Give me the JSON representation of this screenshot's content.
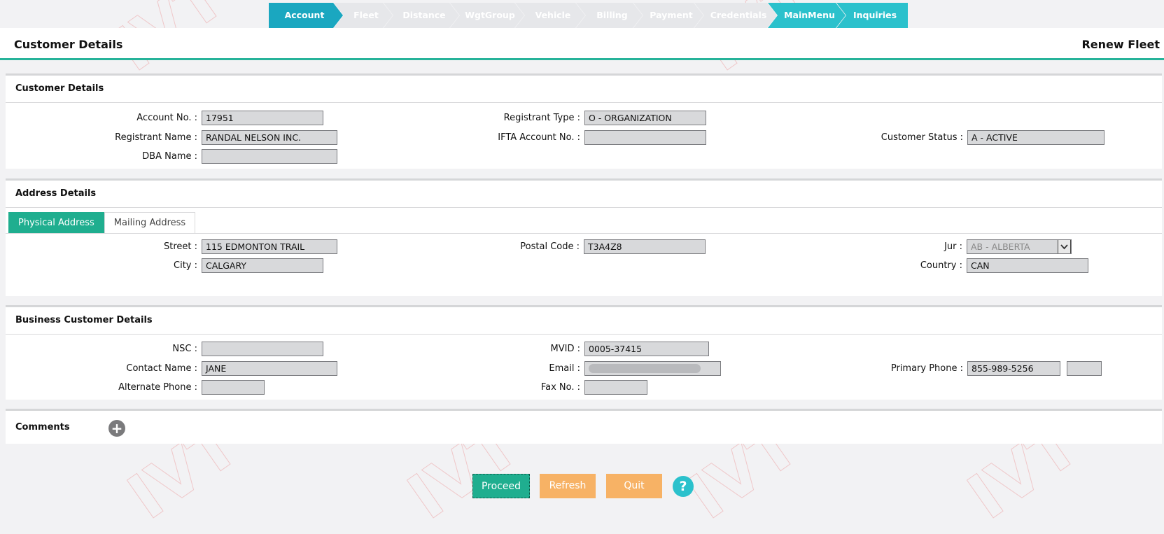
{
  "stepper": {
    "steps": [
      {
        "label": "Account"
      },
      {
        "label": "Fleet"
      },
      {
        "label": "Distance"
      },
      {
        "label": "WgtGroup"
      },
      {
        "label": "Vehicle"
      },
      {
        "label": "Billing"
      },
      {
        "label": "Payment"
      },
      {
        "label": "Credentials"
      },
      {
        "label": "MainMenu"
      },
      {
        "label": "Inquiries"
      }
    ]
  },
  "header": {
    "title": "Customer Details",
    "action": "Renew Fleet"
  },
  "customer_details": {
    "heading": "Customer Details",
    "account_no_label": "Account No.",
    "account_no": "17951",
    "registrant_name_label": "Registrant Name",
    "registrant_name": "RANDAL NELSON INC.",
    "dba_name_label": "DBA Name",
    "dba_name": "",
    "registrant_type_label": "Registrant Type",
    "registrant_type": "O - ORGANIZATION",
    "ifta_label": "IFTA Account No.",
    "ifta": "",
    "status_label": "Customer Status",
    "status": "A - ACTIVE"
  },
  "address_details": {
    "heading": "Address Details",
    "tabs": [
      {
        "label": "Physical Address"
      },
      {
        "label": "Mailing Address"
      }
    ],
    "street_label": "Street",
    "street": "115 EDMONTON TRAIL",
    "city_label": "City",
    "city": "CALGARY",
    "postal_label": "Postal Code",
    "postal": "T3A4Z8",
    "jur_label": "Jur",
    "jur": "AB - ALBERTA",
    "country_label": "Country",
    "country": "CAN"
  },
  "business_details": {
    "heading": "Business Customer Details",
    "nsc_label": "NSC",
    "nsc": "",
    "contact_label": "Contact Name",
    "contact": "JANE",
    "alt_phone_label": "Alternate Phone",
    "alt_phone": "",
    "mvid_label": "MVID",
    "mvid": "0005-37415",
    "email_label": "Email",
    "fax_label": "Fax No.",
    "fax": "",
    "primary_phone_label": "Primary Phone",
    "primary_phone": "855-989-5256",
    "primary_ext": ""
  },
  "comments": {
    "heading": "Comments"
  },
  "footer": {
    "proceed": "Proceed",
    "refresh": "Refresh",
    "quit": "Quit",
    "help": "?"
  }
}
